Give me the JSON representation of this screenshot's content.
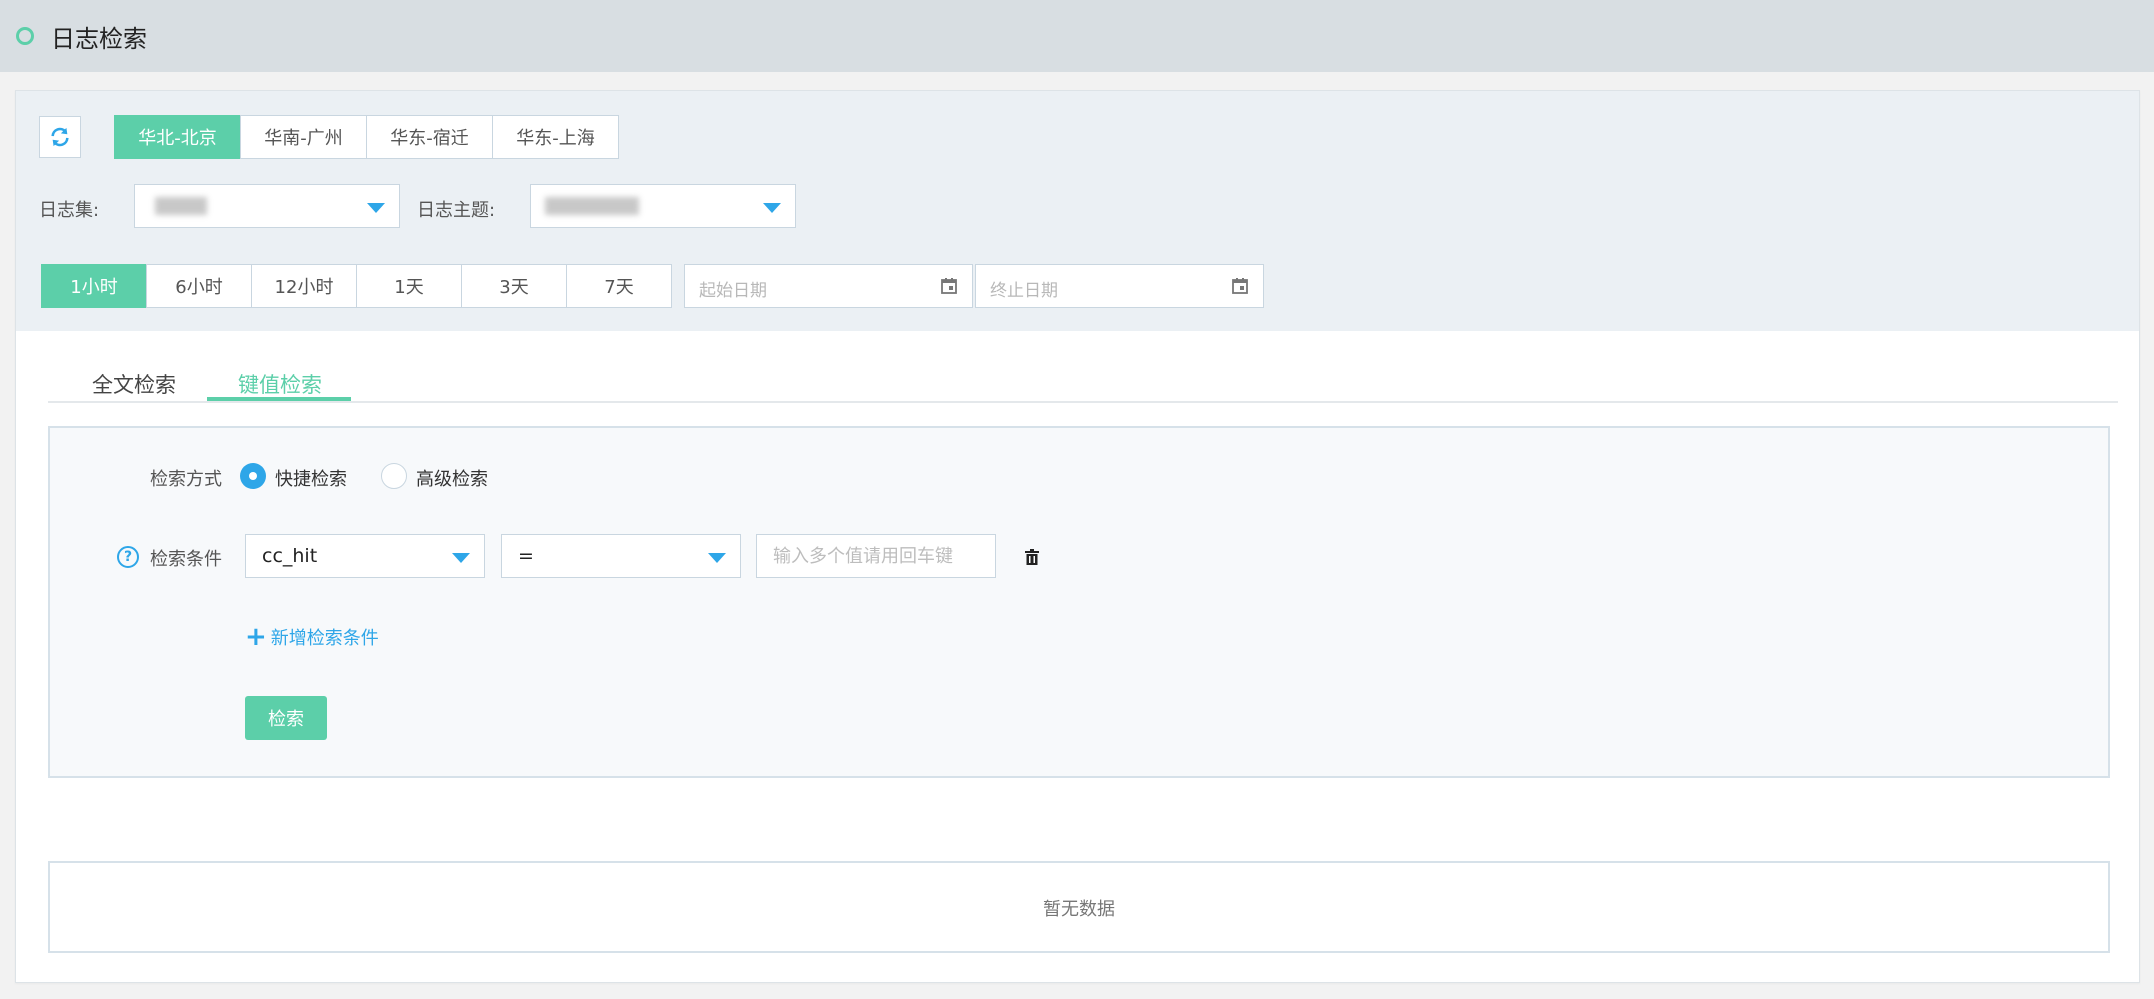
{
  "header": {
    "title": "日志检索"
  },
  "regions": [
    {
      "label": "华北-北京",
      "active": true
    },
    {
      "label": "华南-广州",
      "active": false
    },
    {
      "label": "华东-宿迁",
      "active": false
    },
    {
      "label": "华东-上海",
      "active": false
    }
  ],
  "filters": {
    "logset_label": "日志集:",
    "topic_label": "日志主题:"
  },
  "time_ranges": [
    {
      "label": "1小时",
      "active": true
    },
    {
      "label": "6小时",
      "active": false
    },
    {
      "label": "12小时",
      "active": false
    },
    {
      "label": "1天",
      "active": false
    },
    {
      "label": "3天",
      "active": false
    },
    {
      "label": "7天",
      "active": false
    }
  ],
  "dates": {
    "start_placeholder": "起始日期",
    "end_placeholder": "终止日期"
  },
  "tabs": [
    {
      "label": "全文检索",
      "active": false
    },
    {
      "label": "键值检索",
      "active": true
    }
  ],
  "search": {
    "mode_label": "检索方式",
    "mode_quick": "快捷检索",
    "mode_advanced": "高级检索",
    "condition_label": "检索条件",
    "field_value": "cc_hit",
    "operator_value": "=",
    "value_placeholder": "输入多个值请用回车键",
    "add_condition": "新增检索条件",
    "submit_label": "检索"
  },
  "results": {
    "empty_text": "暂无数据"
  },
  "colors": {
    "accent": "#5ccfa9",
    "link": "#2ea6e8"
  }
}
